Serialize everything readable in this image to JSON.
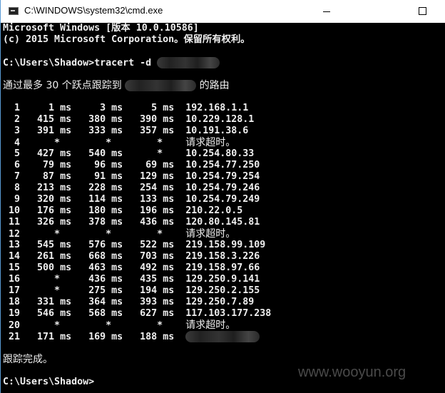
{
  "window": {
    "title": "C:\\WINDOWS\\system32\\cmd.exe"
  },
  "header": {
    "line1": "Microsoft Windows [版本 10.0.10586]",
    "line2": "(c) 2015 Microsoft Corporation。保留所有权利。",
    "command": "C:\\Users\\Shadow>tracert -d ",
    "route_prefix": "通过最多 30 个跃点跟踪到 ",
    "route_suffix": "的路由"
  },
  "hops": [
    {
      "hop": "1",
      "r1": "1",
      "r2": "3",
      "r3": "5",
      "host": "192.168.1.1"
    },
    {
      "hop": "2",
      "r1": "415",
      "r2": "380",
      "r3": "390",
      "host": "10.229.128.1"
    },
    {
      "hop": "3",
      "r1": "391",
      "r2": "333",
      "r3": "357",
      "host": "10.191.38.6"
    },
    {
      "hop": "4",
      "r1": "*",
      "r2": "*",
      "r3": "*",
      "host": "请求超时。"
    },
    {
      "hop": "5",
      "r1": "427",
      "r2": "540",
      "r3": "*",
      "host": "10.254.80.33"
    },
    {
      "hop": "6",
      "r1": "79",
      "r2": "96",
      "r3": "69",
      "host": "10.254.77.250"
    },
    {
      "hop": "7",
      "r1": "87",
      "r2": "91",
      "r3": "129",
      "host": "10.254.79.254"
    },
    {
      "hop": "8",
      "r1": "213",
      "r2": "228",
      "r3": "254",
      "host": "10.254.79.246"
    },
    {
      "hop": "9",
      "r1": "320",
      "r2": "114",
      "r3": "133",
      "host": "10.254.79.249"
    },
    {
      "hop": "10",
      "r1": "176",
      "r2": "180",
      "r3": "196",
      "host": "210.22.0.5"
    },
    {
      "hop": "11",
      "r1": "326",
      "r2": "378",
      "r3": "436",
      "host": "120.80.145.81"
    },
    {
      "hop": "12",
      "r1": "*",
      "r2": "*",
      "r3": "*",
      "host": "请求超时。"
    },
    {
      "hop": "13",
      "r1": "545",
      "r2": "576",
      "r3": "522",
      "host": "219.158.99.109"
    },
    {
      "hop": "14",
      "r1": "261",
      "r2": "668",
      "r3": "703",
      "host": "219.158.3.226"
    },
    {
      "hop": "15",
      "r1": "500",
      "r2": "463",
      "r3": "492",
      "host": "219.158.97.66"
    },
    {
      "hop": "16",
      "r1": "*",
      "r2": "436",
      "r3": "435",
      "host": "129.250.9.141"
    },
    {
      "hop": "17",
      "r1": "*",
      "r2": "275",
      "r3": "194",
      "host": "129.250.2.155"
    },
    {
      "hop": "18",
      "r1": "331",
      "r2": "364",
      "r3": "393",
      "host": "129.250.7.89"
    },
    {
      "hop": "19",
      "r1": "546",
      "r2": "568",
      "r3": "627",
      "host": "117.103.177.238"
    },
    {
      "hop": "20",
      "r1": "*",
      "r2": "*",
      "r3": "*",
      "host": "请求超时。"
    },
    {
      "hop": "21",
      "r1": "171",
      "r2": "169",
      "r3": "188",
      "host": ""
    }
  ],
  "ms_unit": "ms",
  "footer": {
    "done": "跟踪完成。",
    "prompt": "C:\\Users\\Shadow>"
  },
  "watermark": "www.wooyun.org"
}
